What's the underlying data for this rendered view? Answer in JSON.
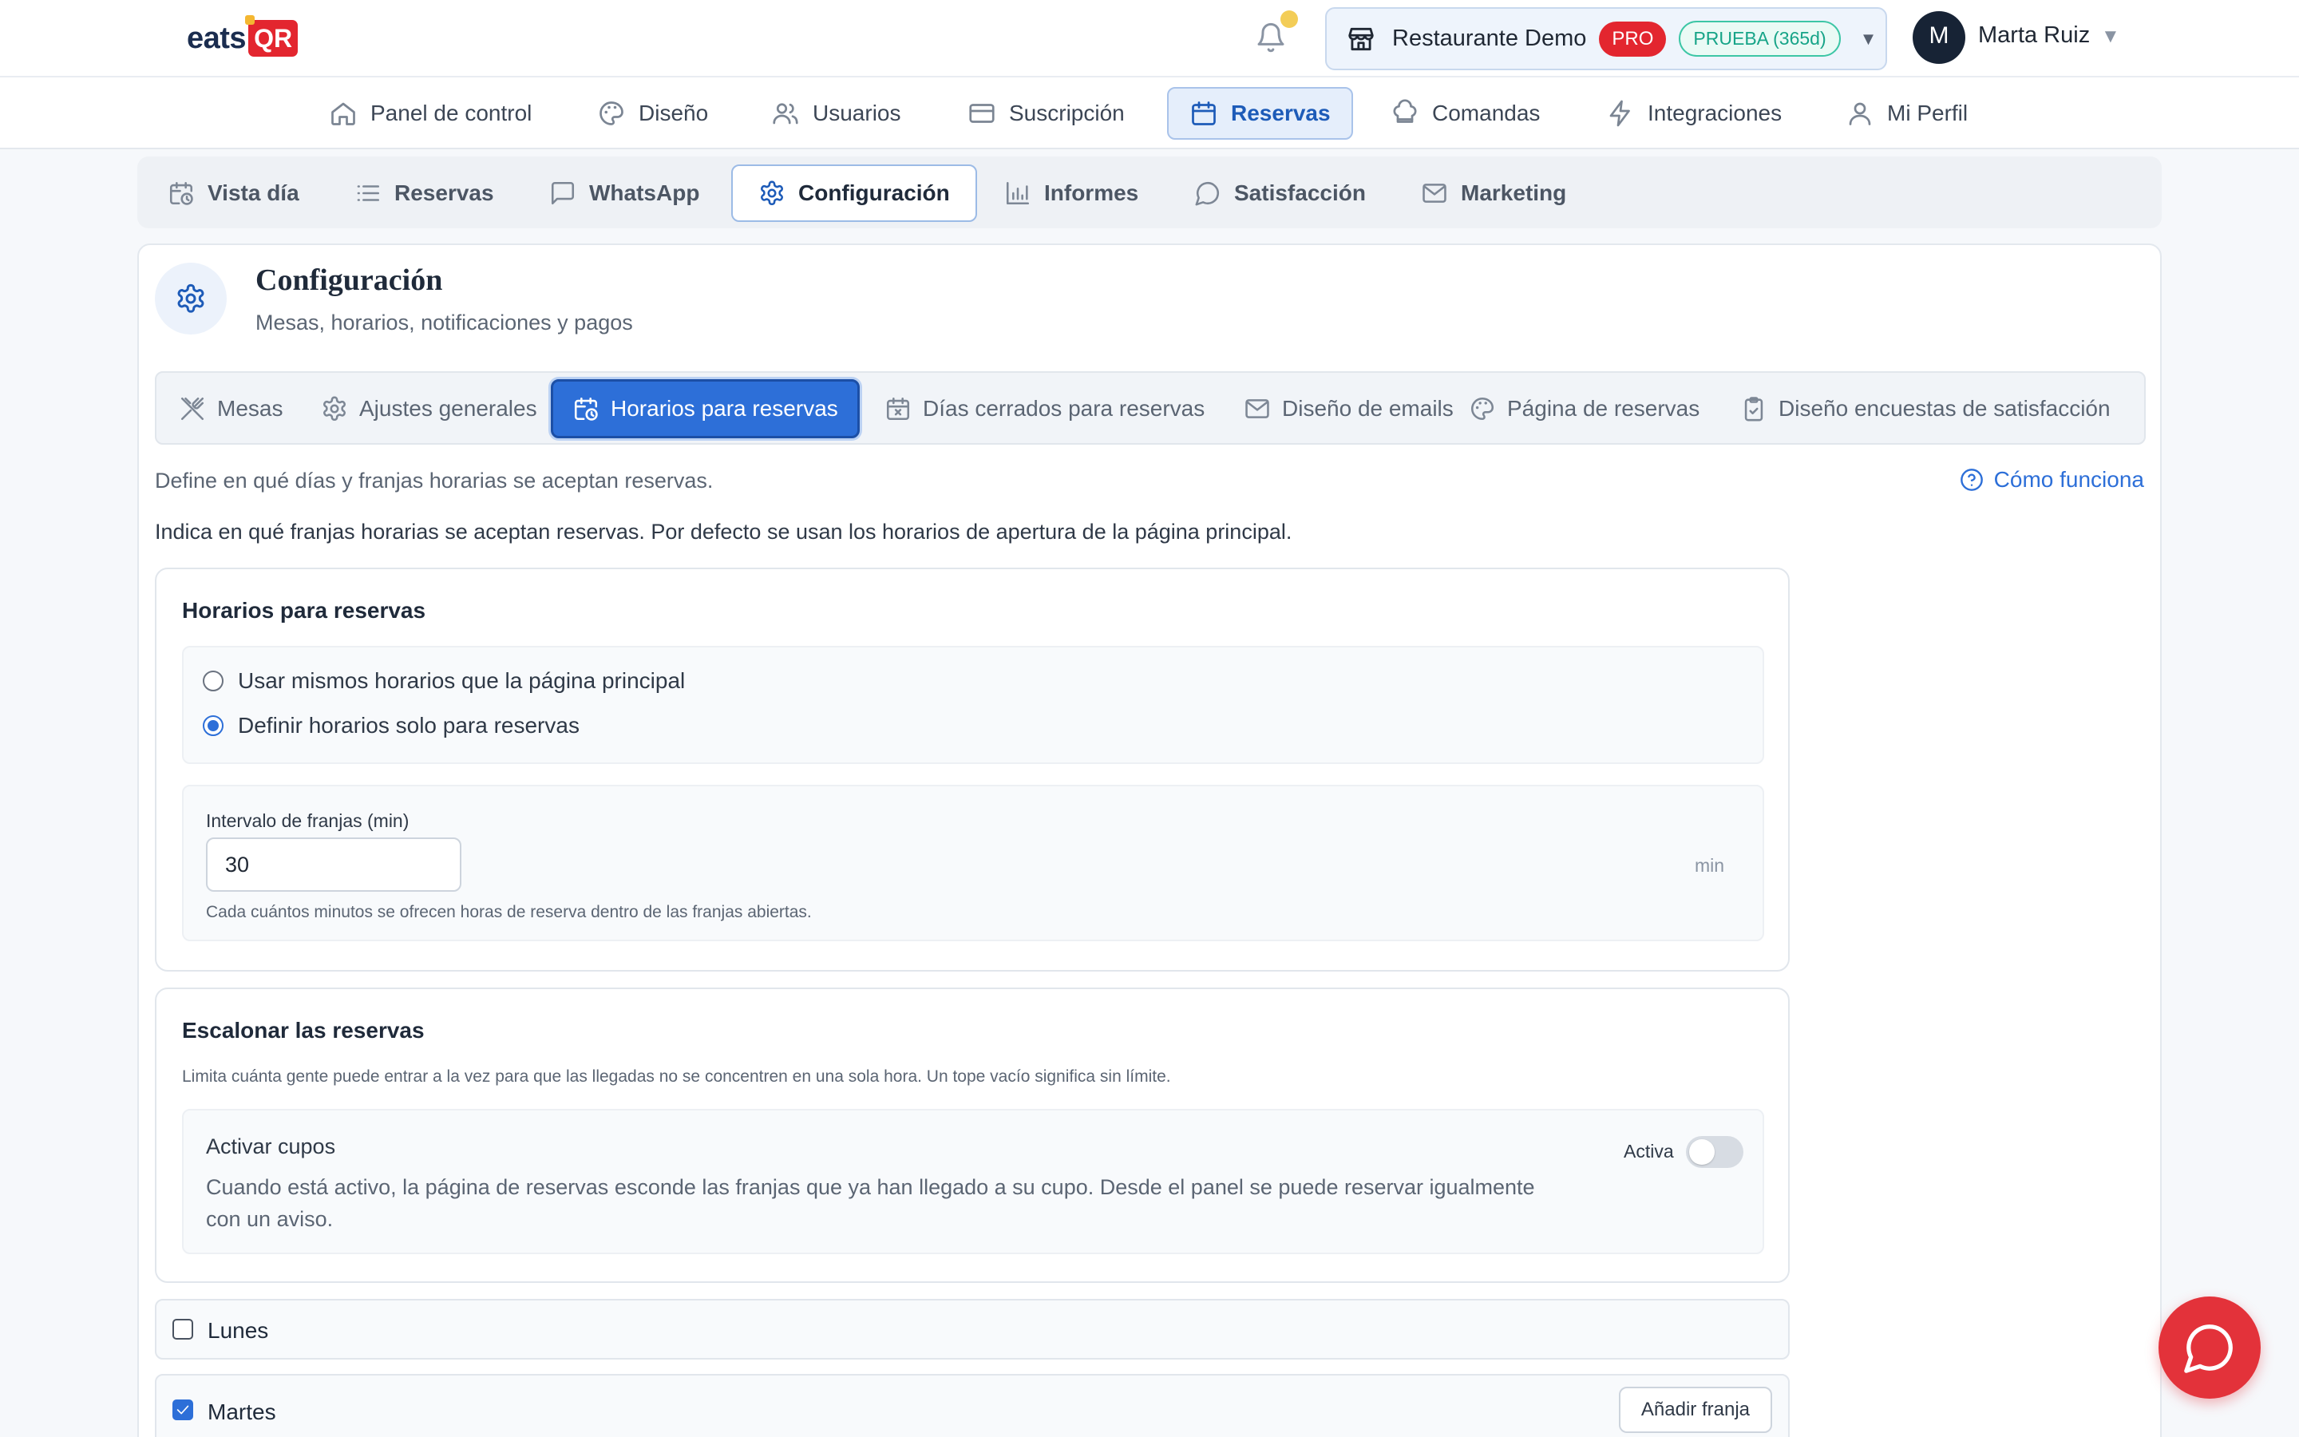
{
  "header": {
    "logo_text": "eats",
    "logo_badge": "QR",
    "restaurant_name": "Restaurante Demo",
    "plan_badge": "PRO",
    "trial_badge": "PRUEBA (365d)",
    "user_initial": "M",
    "user_name": "Marta Ruiz"
  },
  "main_nav": [
    {
      "label": "Panel de control",
      "icon": "home-icon"
    },
    {
      "label": "Diseño",
      "icon": "palette-icon"
    },
    {
      "label": "Usuarios",
      "icon": "users-icon"
    },
    {
      "label": "Suscripción",
      "icon": "credit-card-icon"
    },
    {
      "label": "Reservas",
      "icon": "calendar-icon",
      "active": true
    },
    {
      "label": "Comandas",
      "icon": "chef-hat-icon"
    },
    {
      "label": "Integraciones",
      "icon": "bolt-icon"
    },
    {
      "label": "Mi Perfil",
      "icon": "user-icon"
    }
  ],
  "sub_tabs": [
    {
      "label": "Vista día",
      "icon": "calendar-clock-icon"
    },
    {
      "label": "Reservas",
      "icon": "list-icon"
    },
    {
      "label": "WhatsApp",
      "icon": "message-square-icon"
    },
    {
      "label": "Configuración",
      "icon": "gear-icon",
      "active": true
    },
    {
      "label": "Informes",
      "icon": "bar-chart-icon"
    },
    {
      "label": "Satisfacción",
      "icon": "message-circle-icon"
    },
    {
      "label": "Marketing",
      "icon": "mail-icon"
    }
  ],
  "config": {
    "title": "Configuración",
    "subtitle": "Mesas, horarios, notificaciones y pagos"
  },
  "config_tabs": [
    {
      "label": "Mesas",
      "icon": "utensils-icon"
    },
    {
      "label": "Ajustes generales",
      "icon": "gear-icon"
    },
    {
      "label": "Horarios para reservas",
      "icon": "calendar-clock-icon",
      "active": true
    },
    {
      "label": "Días cerrados para reservas",
      "icon": "calendar-x-icon"
    },
    {
      "label": "Diseño de emails",
      "icon": "mail-icon"
    },
    {
      "label": "Página de reservas",
      "icon": "palette-icon"
    },
    {
      "label": "Diseño encuestas de satisfacción",
      "icon": "clipboard-icon"
    }
  ],
  "content": {
    "define_text": "Define en qué días y franjas horarias se aceptan reservas.",
    "help_link": "Cómo funciona",
    "indica_text": "Indica en qué franjas horarias se aceptan reservas. Por defecto se usan los horarios de apertura de la página principal.",
    "horarios": {
      "title": "Horarios para reservas",
      "option_same": "Usar mismos horarios que la página principal",
      "option_custom": "Definir horarios solo para reservas",
      "selected": "custom",
      "interval_label": "Intervalo de franjas (min)",
      "interval_value": "30",
      "interval_unit": "min",
      "interval_hint": "Cada cuántos minutos se ofrecen horas de reserva dentro de las franjas abiertas."
    },
    "escalonar": {
      "title": "Escalonar las reservas",
      "desc": "Limita cuánta gente puede entrar a la vez para que las llegadas no se concentren en una sola hora. Un tope vacío significa sin límite.",
      "cupos_title": "Activar cupos",
      "cupos_desc_line1": "Cuando está activo, la página de reservas esconde las franjas que ya han llegado a su cupo. Desde el panel se puede reservar igualmente",
      "cupos_desc_line2": "con un aviso.",
      "toggle_label": "Activa",
      "toggle_on": false
    },
    "days": [
      {
        "name": "Lunes",
        "checked": false
      },
      {
        "name": "Martes",
        "checked": true,
        "add_label": "Añadir franja"
      }
    ]
  },
  "colors": {
    "accent": "#2d6fd8",
    "brand_red": "#e3262f",
    "trial_green": "#17a488"
  }
}
